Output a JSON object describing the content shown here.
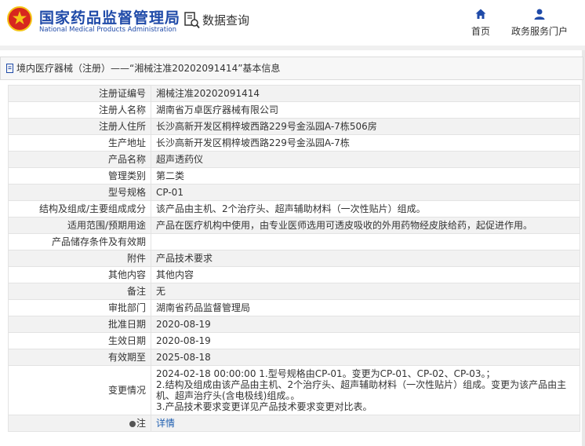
{
  "header": {
    "logo_cn": "国家药品监督管理局",
    "logo_en": "National Medical Products Administration",
    "query_label": "数据查询",
    "nav": [
      {
        "label": "首页",
        "icon": "home-icon"
      },
      {
        "label": "政务服务门户",
        "icon": "user-icon"
      }
    ]
  },
  "breadcrumb": {
    "text": "境内医疗器械（注册）——“湘械注准20202091414”基本信息",
    "icon": "document-icon"
  },
  "detail": {
    "rows": [
      {
        "label": "注册证编号",
        "value": "湘械注准20202091414"
      },
      {
        "label": "注册人名称",
        "value": "湖南省万卓医疗器械有限公司"
      },
      {
        "label": "注册人住所",
        "value": "长沙高新开发区桐梓坡西路229号金泓园A-7栋506房"
      },
      {
        "label": "生产地址",
        "value": "长沙高新开发区桐梓坡西路229号金泓园A-7栋"
      },
      {
        "label": "产品名称",
        "value": "超声透药仪"
      },
      {
        "label": "管理类别",
        "value": "第二类"
      },
      {
        "label": "型号规格",
        "value": "CP-01"
      },
      {
        "label": "结构及组成/主要组成成分",
        "value": "该产品由主机、2个治疗头、超声辅助材料（一次性贴片）组成。"
      },
      {
        "label": "适用范围/预期用途",
        "value": "产品在医疗机构中使用，由专业医师选用可透皮吸收的外用药物经皮肤给药，起促进作用。"
      },
      {
        "label": "产品储存条件及有效期",
        "value": ""
      },
      {
        "label": "附件",
        "value": "产品技术要求"
      },
      {
        "label": "其他内容",
        "value": "其他内容"
      },
      {
        "label": "备注",
        "value": "无"
      },
      {
        "label": "审批部门",
        "value": "湖南省药品监督管理局"
      },
      {
        "label": "批准日期",
        "value": "2020-08-19"
      },
      {
        "label": "生效日期",
        "value": "2020-08-19"
      },
      {
        "label": "有效期至",
        "value": "2025-08-18"
      }
    ],
    "change": {
      "label": "变更情况",
      "lines": [
        "2024-02-18 00:00:00 1.型号规格由CP-01。变更为CP-01、CP-02、CP-03。；",
        "2.结构及组成由该产品由主机、2个治疗头、超声辅助材料（一次性贴片）组成。变更为该产品由主机、超声治疗头(含电极线)组成。。",
        "3.产品技术要求变更详见产品技术要求变更对比表。"
      ]
    },
    "note": {
      "label": "注",
      "link": "详情",
      "icon": "info-icon"
    }
  },
  "colors": {
    "brand": "#1f4aa8",
    "link": "#1f5fb0",
    "row_alt": "#f2f2f2",
    "emblem_red": "#d7261e",
    "emblem_gold": "#f5c518"
  }
}
